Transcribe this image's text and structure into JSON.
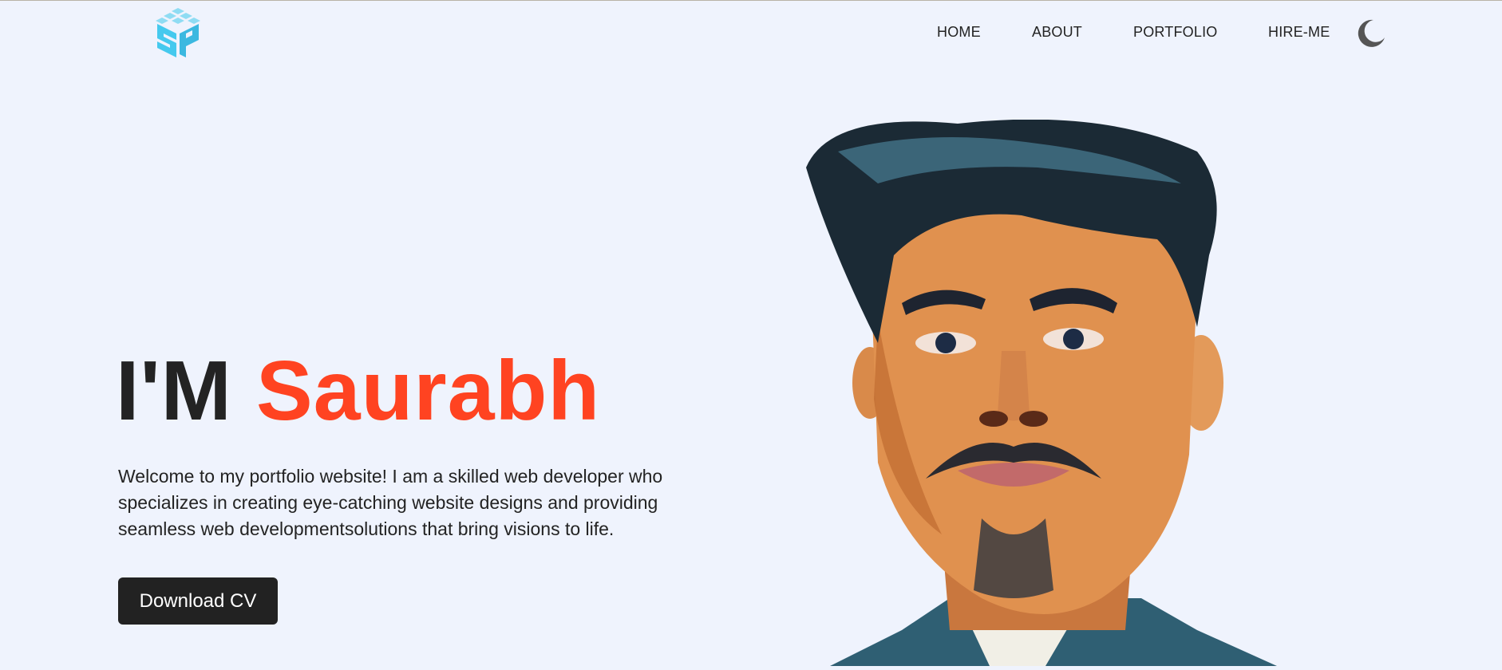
{
  "header": {
    "logo_text": "SP",
    "nav": [
      {
        "label": "HOME"
      },
      {
        "label": "ABOUT"
      },
      {
        "label": "PORTFOLIO"
      },
      {
        "label": "HIRE-ME"
      }
    ],
    "theme_toggle_icon": "moon-icon"
  },
  "hero": {
    "lead": "I'M",
    "name": "Saurabh",
    "intro": "Welcome to my portfolio website! I am a skilled web developer who specializes in creating eye-catching website designs and providing seamless web developmentsolutions that bring visions to life.",
    "cta_label": "Download CV",
    "portrait_icon": "profile-portrait"
  },
  "colors": {
    "background": "#eff3fd",
    "accent": "#ff4321",
    "text": "#232323",
    "button_bg": "#222222",
    "logo": "#45c9ee"
  }
}
